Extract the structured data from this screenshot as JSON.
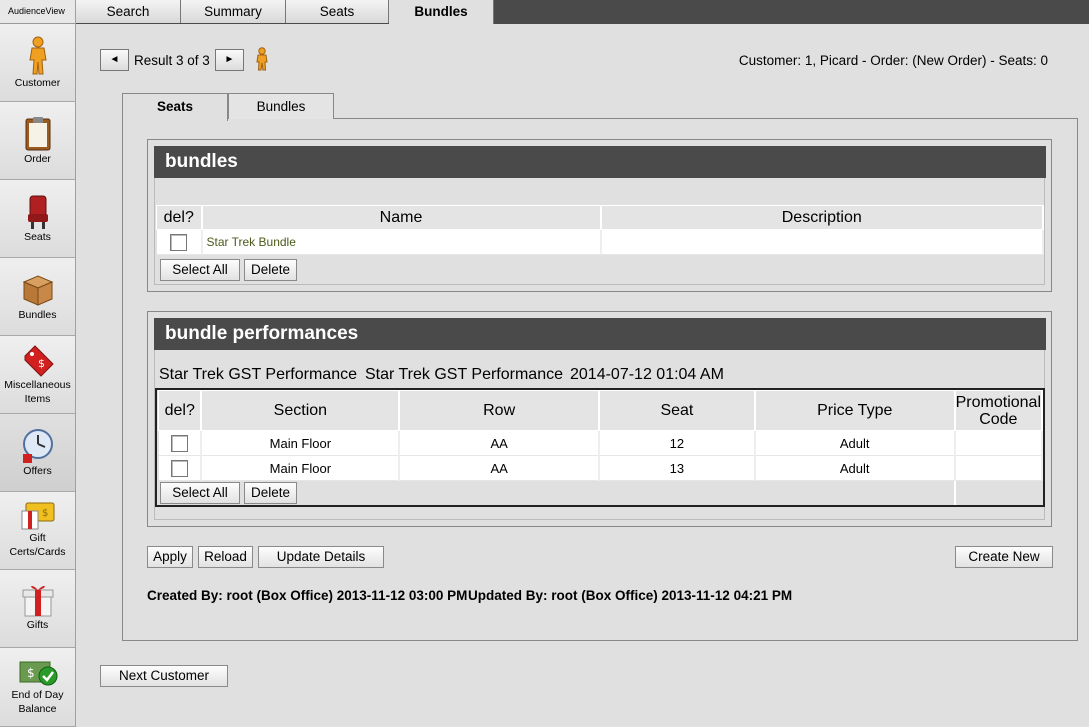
{
  "app": {
    "brand": "AudienceView"
  },
  "sidebar": {
    "items": [
      {
        "label": "Customer",
        "icon": "person-icon"
      },
      {
        "label": "Order",
        "icon": "clipboard-icon"
      },
      {
        "label": "Seats",
        "icon": "seat-icon"
      },
      {
        "label": "Bundles",
        "icon": "box-icon"
      },
      {
        "label": "Miscellaneous Items",
        "icon": "price-tag-icon"
      },
      {
        "label": "Offers",
        "icon": "clock-icon"
      },
      {
        "label": "Gift Certs/Cards",
        "icon": "gift-card-icon"
      },
      {
        "label": "Gifts",
        "icon": "gift-icon"
      },
      {
        "label": "End of Day Balance",
        "icon": "money-check-icon"
      }
    ]
  },
  "top_tabs": [
    "Search",
    "Summary",
    "Seats",
    "Bundles"
  ],
  "top_tabs_active": "Bundles",
  "result_nav": {
    "text": "Result 3 of 3",
    "prev": "◄",
    "next": "►"
  },
  "customer_info": "Customer: 1, Picard - Order: (New Order) - Seats: 0",
  "inner_tabs": [
    "Seats",
    "Bundles"
  ],
  "inner_tabs_active": "Seats",
  "bundles_section": {
    "title": "bundles",
    "columns": [
      "del?",
      "Name",
      "Description"
    ],
    "rows": [
      {
        "name": "Star Trek Bundle",
        "description": ""
      }
    ],
    "select_all": "Select All",
    "delete": "Delete"
  },
  "performances_section": {
    "title": "bundle performances",
    "performance_name1": "Star Trek GST Performance",
    "performance_name2": "Star Trek GST Performance",
    "performance_date": "2014-07-12 01:04 AM",
    "columns": [
      "del?",
      "Section",
      "Row",
      "Seat",
      "Price Type",
      "Promotional Code"
    ],
    "rows": [
      {
        "section": "Main Floor",
        "row": "AA",
        "seat": "12",
        "price_type": "Adult",
        "promo": ""
      },
      {
        "section": "Main Floor",
        "row": "AA",
        "seat": "13",
        "price_type": "Adult",
        "promo": ""
      }
    ],
    "select_all": "Select All",
    "delete": "Delete"
  },
  "actions": {
    "apply": "Apply",
    "reload": "Reload",
    "update_details": "Update Details",
    "create_new": "Create New"
  },
  "audit": {
    "created": "Created By: root (Box Office) 2013-11-12 03:00 PM",
    "updated": "Updated By: root (Box Office) 2013-11-12 04:21 PM"
  },
  "next_customer": "Next Customer",
  "colors": {
    "header_dark": "#4a4a4a",
    "background": "#e0e0e0",
    "link": "#4a5a1a"
  }
}
